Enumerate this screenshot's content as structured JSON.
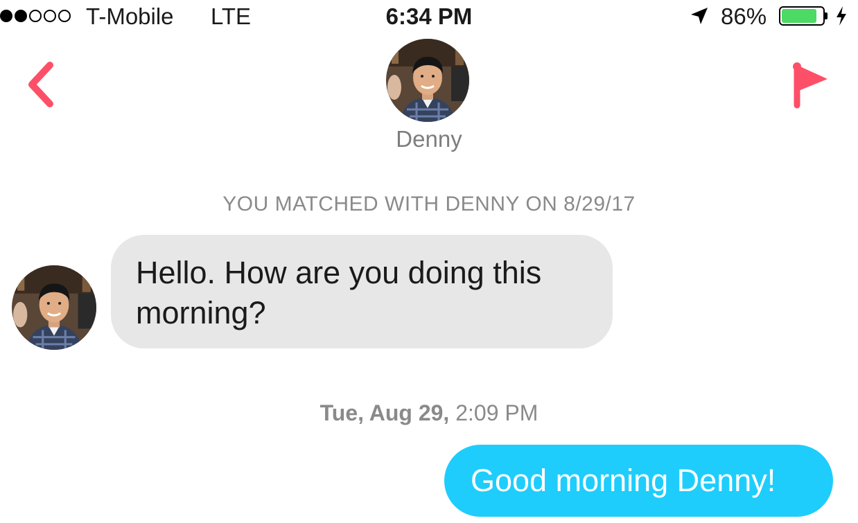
{
  "status_bar": {
    "carrier": "T-Mobile",
    "network": "LTE",
    "time": "6:34 PM",
    "battery_percent": "86%",
    "battery_level": 0.86,
    "signal_bars_filled": 2,
    "signal_bars_total": 5,
    "icons": [
      "location-arrow-icon",
      "battery-icon",
      "charging-bolt-icon"
    ]
  },
  "header": {
    "back_icon": "chevron-left-icon",
    "report_icon": "flag-icon",
    "contact_name": "Denny"
  },
  "match_notice": "YOU MATCHED WITH DENNY ON 8/29/17",
  "messages": [
    {
      "direction": "incoming",
      "text": "Hello. How are you doing this morning?"
    },
    {
      "direction": "outgoing",
      "text": "Good morning Denny!"
    }
  ],
  "timestamp": {
    "day": "Tue, Aug 29,",
    "time": "2:09 PM"
  },
  "colors": {
    "accent": "#fd5068",
    "incoming_bubble": "#e7e7e7",
    "outgoing_bubble": "#1ecdfc",
    "battery": "#4cd964"
  }
}
